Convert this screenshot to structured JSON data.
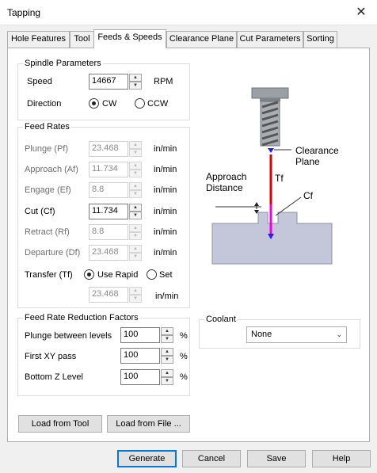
{
  "window": {
    "title": "Tapping",
    "close_glyph": "✕"
  },
  "tabs": [
    {
      "label": "Hole Features"
    },
    {
      "label": "Tool"
    },
    {
      "label": "Feeds & Speeds",
      "active": true
    },
    {
      "label": "Clearance Plane"
    },
    {
      "label": "Cut Parameters"
    },
    {
      "label": "Sorting"
    }
  ],
  "spindle": {
    "group_label": "Spindle Parameters",
    "speed_label": "Speed",
    "speed_value": "14667",
    "speed_unit": "RPM",
    "direction_label": "Direction",
    "cw_label": "CW",
    "ccw_label": "CCW",
    "direction_selected": "CW"
  },
  "feed_rates": {
    "group_label": "Feed Rates",
    "unit": "in/min",
    "rows": [
      {
        "label": "Plunge (Pf)",
        "value": "23.468",
        "enabled": false
      },
      {
        "label": "Approach (Af)",
        "value": "11.734",
        "enabled": false
      },
      {
        "label": "Engage (Ef)",
        "value": "8.8",
        "enabled": false
      },
      {
        "label": "Cut (Cf)",
        "value": "11.734",
        "enabled": true
      },
      {
        "label": "Retract (Rf)",
        "value": "8.8",
        "enabled": false
      },
      {
        "label": "Departure  (Df)",
        "value": "23.468",
        "enabled": false
      }
    ],
    "transfer_label": "Transfer (Tf)",
    "use_rapid_label": "Use Rapid",
    "set_label": "Set",
    "transfer_selected": "Use Rapid",
    "transfer_value": "23.468"
  },
  "reduction": {
    "group_label": "Feed Rate Reduction Factors",
    "rows": [
      {
        "label": "Plunge between levels",
        "value": "100",
        "unit": "%"
      },
      {
        "label": "First XY pass",
        "value": "100",
        "unit": "%"
      },
      {
        "label": "Bottom Z Level",
        "value": "100",
        "unit": "%"
      }
    ]
  },
  "coolant": {
    "group_label": "Coolant",
    "selected": "None"
  },
  "diagram": {
    "clearance_label_1": "Clearance",
    "clearance_label_2": "Plane",
    "tf_label": "Tf",
    "approach_label_1": "Approach",
    "approach_label_2": "Distance",
    "cf_label": "Cf",
    "colors": {
      "rapid": "#dd0000",
      "cut": "#ee00ee",
      "clearance": "#1f1fff",
      "stock": "#c3c7d9"
    }
  },
  "load_buttons": {
    "load_tool": "Load from Tool",
    "load_file": "Load from File ..."
  },
  "footer": {
    "generate": "Generate",
    "cancel": "Cancel",
    "save": "Save",
    "help": "Help"
  }
}
